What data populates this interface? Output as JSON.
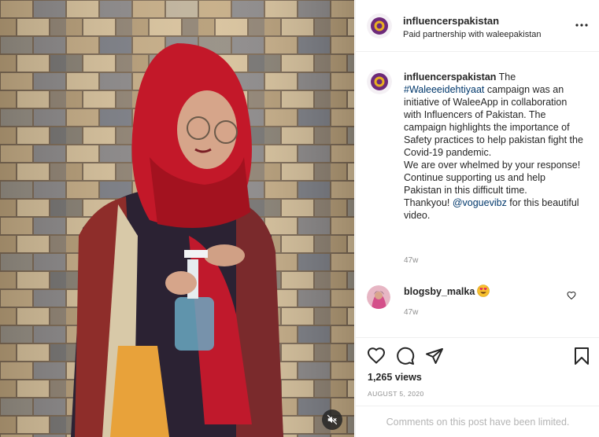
{
  "post": {
    "author": "influencerspakistan",
    "partnership": "Paid partnership with waleepakistan",
    "caption": {
      "username": "influencerspakistan",
      "text_before": " The ",
      "hashtag": "#Waleeeidehtiyaat",
      "text_middle": " campaign was an initiative of WaleeApp in collaboration with Influencers of Pakistan. The campaign highlights the importance of Safety practices to help pakistan fight the Covid-19 pandemic.",
      "line2": "We are over whelmed by your response! Continue supporting us and help Pakistan in this difficult time.",
      "thanks": "Thankyou! ",
      "mention": "@voguevibz",
      "text_after": " for this beautiful video.",
      "time": "47w"
    },
    "comments": [
      {
        "username": "blogsby_malka",
        "emoji": "heart-eyes-emoji",
        "time": "47w"
      }
    ],
    "views": "1,265 views",
    "date": "AUGUST 5, 2020",
    "comments_limited": "Comments on this post have been limited."
  },
  "icons": {
    "more": "more-horizontal-icon",
    "like": "heart-icon",
    "comment": "comment-icon",
    "share": "paper-plane-icon",
    "save": "bookmark-icon",
    "mute": "speaker-muted-icon"
  },
  "colors": {
    "link": "#00376b",
    "secondary_text": "#8e8e8e",
    "border": "#efefef",
    "avatar_ring": "#6d2a7a",
    "avatar_dot": "#e8b020"
  }
}
